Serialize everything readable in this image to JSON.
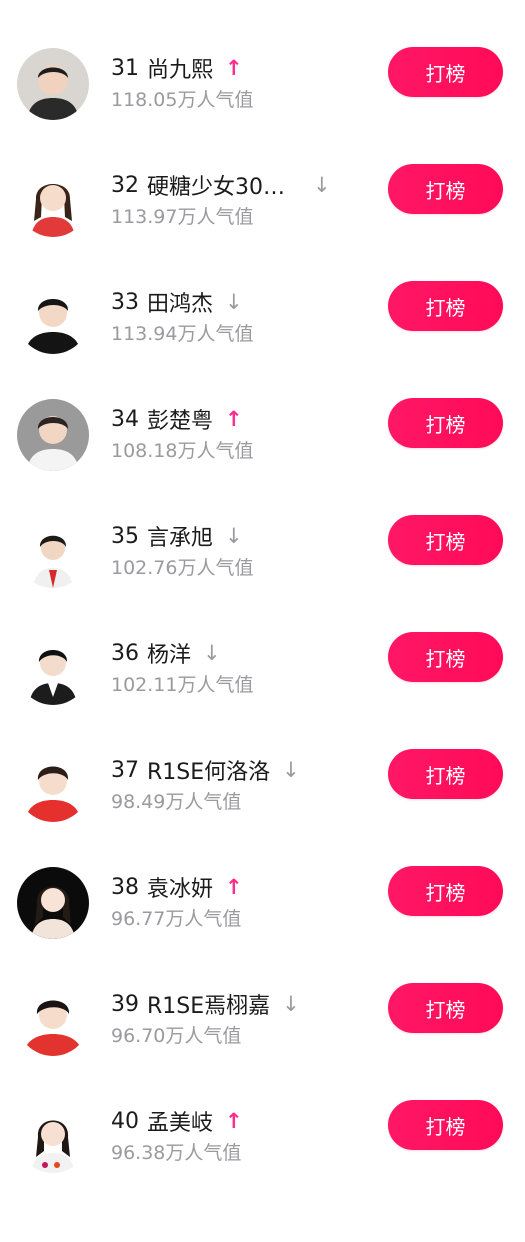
{
  "button_label": "打榜",
  "colors": {
    "accent": "#ff1766",
    "up_arrow": "#ff2d8c",
    "down_arrow": "#9a9aa0",
    "secondary_text": "#9a9aa0"
  },
  "items": [
    {
      "rank": "31",
      "name": "尚九熙",
      "trend": "up",
      "trend_symbol": "↑",
      "popularity": "118.05万人气值",
      "avatar_bg": "#d9d6d2",
      "avatar_icon": "portrait-male"
    },
    {
      "rank": "32",
      "name": "硬糖少女30…",
      "trend": "down",
      "trend_symbol": "↓",
      "popularity": "113.97万人气值",
      "avatar_bg": "#ffffff",
      "avatar_icon": "portrait-female"
    },
    {
      "rank": "33",
      "name": "田鸿杰",
      "trend": "down",
      "trend_symbol": "↓",
      "popularity": "113.94万人气值",
      "avatar_bg": "#ffffff",
      "avatar_icon": "portrait-male"
    },
    {
      "rank": "34",
      "name": "彭楚粤",
      "trend": "up",
      "trend_symbol": "↑",
      "popularity": "108.18万人气值",
      "avatar_bg": "#9a9a9a",
      "avatar_icon": "portrait-male"
    },
    {
      "rank": "35",
      "name": "言承旭",
      "trend": "down",
      "trend_symbol": "↓",
      "popularity": "102.76万人气值",
      "avatar_bg": "#ffffff",
      "avatar_icon": "portrait-male"
    },
    {
      "rank": "36",
      "name": "杨洋",
      "trend": "down",
      "trend_symbol": "↓",
      "popularity": "102.11万人气值",
      "avatar_bg": "#ffffff",
      "avatar_icon": "portrait-male"
    },
    {
      "rank": "37",
      "name": "R1SE何洛洛",
      "trend": "down",
      "trend_symbol": "↓",
      "popularity": "98.49万人气值",
      "avatar_bg": "#ffffff",
      "avatar_icon": "portrait-male"
    },
    {
      "rank": "38",
      "name": "袁冰妍",
      "trend": "up",
      "trend_symbol": "↑",
      "popularity": "96.77万人气值",
      "avatar_bg": "#0b0b0b",
      "avatar_icon": "portrait-female"
    },
    {
      "rank": "39",
      "name": "R1SE焉栩嘉",
      "trend": "down",
      "trend_symbol": "↓",
      "popularity": "96.70万人气值",
      "avatar_bg": "#ffffff",
      "avatar_icon": "portrait-male"
    },
    {
      "rank": "40",
      "name": "孟美岐",
      "trend": "up",
      "trend_symbol": "↑",
      "popularity": "96.38万人气值",
      "avatar_bg": "#ffffff",
      "avatar_icon": "portrait-female"
    }
  ]
}
